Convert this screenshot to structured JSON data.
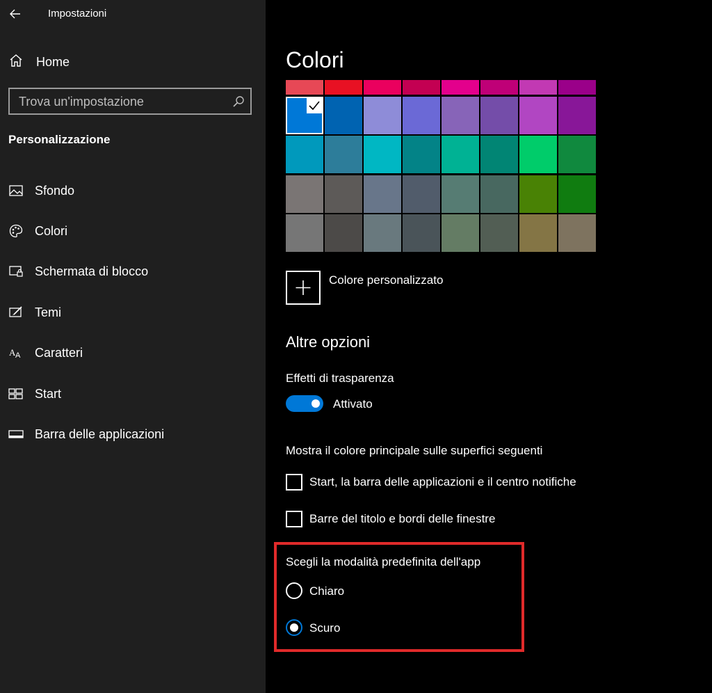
{
  "window": {
    "title": "Impostazioni",
    "back_icon": "back-arrow-icon"
  },
  "sidebar": {
    "home_label": "Home",
    "search_placeholder": "Trova un'impostazione",
    "section_title": "Personalizzazione",
    "items": [
      {
        "label": "Sfondo",
        "icon": "picture-icon"
      },
      {
        "label": "Colori",
        "icon": "palette-icon"
      },
      {
        "label": "Schermata di blocco",
        "icon": "lock-screen-icon"
      },
      {
        "label": "Temi",
        "icon": "themes-icon"
      },
      {
        "label": "Caratteri",
        "icon": "fonts-icon"
      },
      {
        "label": "Start",
        "icon": "start-icon"
      },
      {
        "label": "Barra delle applicazioni",
        "icon": "taskbar-icon"
      }
    ]
  },
  "main": {
    "title": "Colori",
    "palette": {
      "top_row": [
        "#e74856",
        "#e81123",
        "#ea005e",
        "#c30052",
        "#e3008c",
        "#bf0077",
        "#c239b3",
        "#9a0089"
      ],
      "rows": [
        [
          "#0078d7",
          "#0063b1",
          "#8e8cd8",
          "#6b69d6",
          "#8764b8",
          "#744da9",
          "#b146c2",
          "#881798"
        ],
        [
          "#0099bc",
          "#2d7d9a",
          "#00b7c3",
          "#038387",
          "#00b294",
          "#018574",
          "#00cc6a",
          "#10893e"
        ],
        [
          "#7a7574",
          "#5d5a58",
          "#68768a",
          "#515c6b",
          "#567c73",
          "#486860",
          "#498205",
          "#107c10"
        ],
        [
          "#767676",
          "#4c4a48",
          "#69797e",
          "#4a5459",
          "#647c64",
          "#525e54",
          "#847545",
          "#7e735f"
        ]
      ],
      "selected": "#0078d7"
    },
    "custom_color_label": "Colore personalizzato",
    "more_options_title": "Altre opzioni",
    "transparency_label": "Effetti di trasparenza",
    "transparency_state": "Attivato",
    "accent_surfaces_label": "Mostra il colore principale sulle superfici seguenti",
    "checkbox_start_label": "Start, la barra delle applicazioni e il centro notifiche",
    "checkbox_titlebars_label": "Barre del titolo e bordi delle finestre",
    "app_mode_label": "Scegli la modalità predefinita dell'app",
    "mode_light_label": "Chiaro",
    "mode_dark_label": "Scuro",
    "selected_mode": "Scuro"
  },
  "colors": {
    "accent": "#0078d7",
    "highlight_border": "#e02a2a",
    "sidebar_bg": "#1f1f1f",
    "main_bg": "#000000"
  }
}
